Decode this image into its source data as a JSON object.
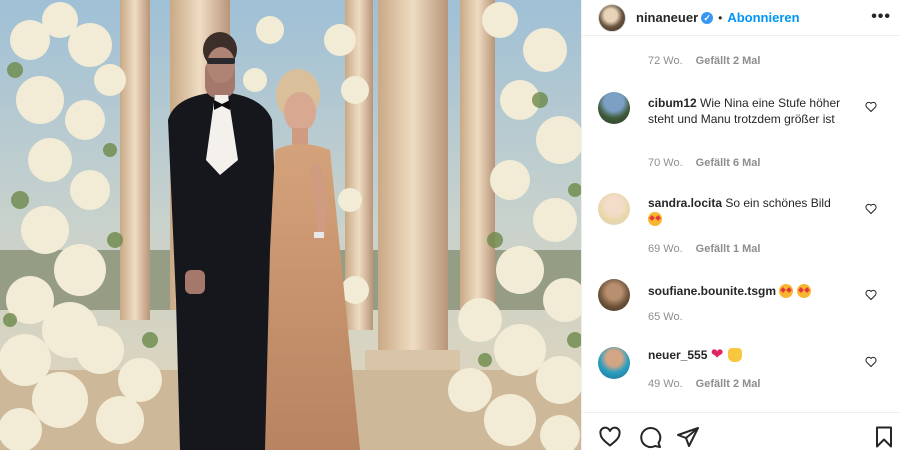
{
  "post": {
    "username": "ninaneuer",
    "verified_glyph": "✓",
    "separator": "•",
    "follow_label": "Abonnieren",
    "more_label": "•••"
  },
  "caption_meta": {
    "time": "72 Wo.",
    "likes": "Gefällt 2 Mal"
  },
  "comments": [
    {
      "user": "cibum12",
      "text": "Wie Nina eine Stufe höher steht und Manu trotzdem größer ist",
      "time": "70 Wo.",
      "likes": "Gefällt 6 Mal",
      "emoji": []
    },
    {
      "user": "sandra.locita",
      "text": "So ein schönes Bild",
      "time": "69 Wo.",
      "likes": "Gefällt 1 Mal",
      "emoji": [
        "star-struck"
      ]
    },
    {
      "user": "soufiane.bounite.tsgm",
      "text": "",
      "time": "65 Wo.",
      "likes": "",
      "emoji": [
        "star-struck",
        "star-struck"
      ]
    },
    {
      "user": "neuer_555",
      "text": "",
      "time": "49 Wo.",
      "likes": "Gefällt 2 Mal",
      "emoji": [
        "red-heart",
        "raising-hands"
      ]
    }
  ],
  "icons": {
    "like": "heart-outline-icon",
    "comment": "comment-bubble-icon",
    "share": "paper-plane-icon",
    "save": "bookmark-icon"
  },
  "colors": {
    "accent": "#0095f6",
    "text": "#262626",
    "muted": "#8e8e8e",
    "verified": "#3897f0"
  }
}
